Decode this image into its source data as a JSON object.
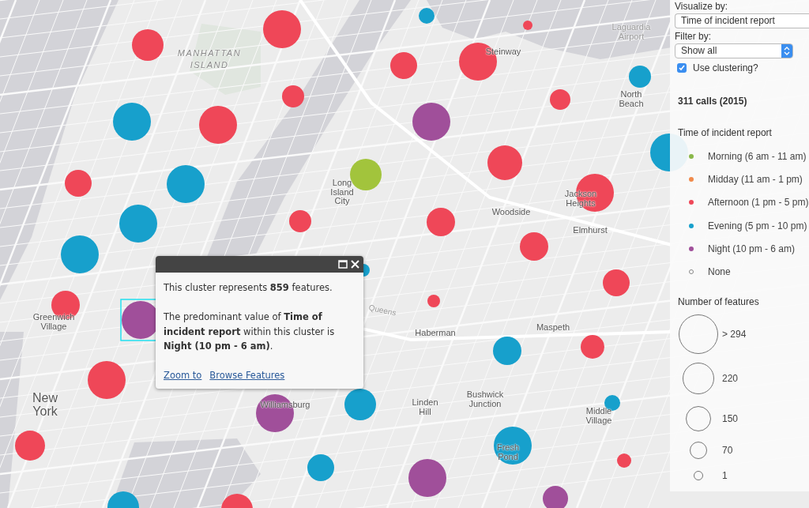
{
  "map": {
    "labels": [
      {
        "lines": [
          "MANHATTAN",
          "ISLAND"
        ],
        "kind": "area"
      },
      {
        "lines": [
          "Long",
          "Island",
          "City"
        ],
        "kind": "place"
      },
      {
        "lines": [
          "Steinway"
        ],
        "kind": "place"
      },
      {
        "lines": [
          "Laguardia",
          "Airport"
        ],
        "kind": "faint"
      },
      {
        "lines": [
          "North",
          "Beach"
        ],
        "kind": "place"
      },
      {
        "lines": [
          "Jackson",
          "Heights"
        ],
        "kind": "place"
      },
      {
        "lines": [
          "Woodside"
        ],
        "kind": "place"
      },
      {
        "lines": [
          "Elmhurst"
        ],
        "kind": "place"
      },
      {
        "lines": [
          "Greenwich",
          "Village"
        ],
        "kind": "place"
      },
      {
        "lines": [
          "New",
          "York"
        ],
        "kind": "city"
      },
      {
        "lines": [
          "Queens"
        ],
        "kind": "road"
      },
      {
        "lines": [
          "Haberman"
        ],
        "kind": "place"
      },
      {
        "lines": [
          "Maspeth"
        ],
        "kind": "place"
      },
      {
        "lines": [
          "Williamsburg"
        ],
        "kind": "place"
      },
      {
        "lines": [
          "Linden",
          "Hill"
        ],
        "kind": "place"
      },
      {
        "lines": [
          "Bushwick",
          "Junction"
        ],
        "kind": "place"
      },
      {
        "lines": [
          "Middle",
          "Village"
        ],
        "kind": "place"
      },
      {
        "lines": [
          "Fresh",
          "Pond"
        ],
        "kind": "place"
      }
    ],
    "clusters": [
      {
        "color": "#ef4758",
        "selected": false
      },
      {
        "color": "#ef4758",
        "selected": false
      },
      {
        "color": "#17a0cc",
        "selected": false
      },
      {
        "color": "#ef4758",
        "selected": false
      },
      {
        "color": "#ef4758",
        "selected": false
      },
      {
        "color": "#ef4758",
        "selected": false
      },
      {
        "color": "#ef4758",
        "selected": false
      },
      {
        "color": "#ef4758",
        "selected": false
      },
      {
        "color": "#17a0cc",
        "selected": false
      },
      {
        "color": "#a04f9a",
        "selected": false
      },
      {
        "color": "#ef4758",
        "selected": false
      },
      {
        "color": "#17a0cc",
        "selected": false
      },
      {
        "color": "#a2c43c",
        "selected": false
      },
      {
        "color": "#ef4758",
        "selected": false
      },
      {
        "color": "#17a0cc",
        "selected": false
      },
      {
        "color": "#ef4758",
        "selected": false
      },
      {
        "color": "#ef4758",
        "selected": false
      },
      {
        "color": "#17a0cc",
        "selected": false
      },
      {
        "color": "#17a0cc",
        "selected": false
      },
      {
        "color": "#ef4758",
        "selected": false
      },
      {
        "color": "#ef4758",
        "selected": false
      },
      {
        "color": "#ef4758",
        "selected": false
      },
      {
        "color": "#17a0cc",
        "selected": false
      },
      {
        "color": "#ef4758",
        "selected": false
      },
      {
        "color": "#17a0cc",
        "selected": false
      },
      {
        "color": "#ef4758",
        "selected": false
      },
      {
        "color": "#ef4758",
        "selected": false
      },
      {
        "color": "#a04f9a",
        "selected": true
      },
      {
        "color": "#17a0cc",
        "selected": false
      },
      {
        "color": "#ef4758",
        "selected": false
      },
      {
        "color": "#ef4758",
        "selected": false
      },
      {
        "color": "#ef4758",
        "selected": false
      },
      {
        "color": "#a04f9a",
        "selected": false
      },
      {
        "color": "#17a0cc",
        "selected": false
      },
      {
        "color": "#17a0cc",
        "selected": false
      },
      {
        "color": "#17a0cc",
        "selected": false
      },
      {
        "color": "#17a0cc",
        "selected": false
      },
      {
        "color": "#a04f9a",
        "selected": false
      },
      {
        "color": "#ef4758",
        "selected": false
      },
      {
        "color": "#a04f9a",
        "selected": false
      },
      {
        "color": "#17a0cc",
        "selected": false
      },
      {
        "color": "#ef4758",
        "selected": false
      }
    ]
  },
  "popup": {
    "paragraphs": [
      "This cluster represents **859** features.",
      "The predominant value of **Time of incident report** within this cluster is **Night (10 pm - 6 am)**."
    ],
    "links": [
      "Zoom to",
      "Browse Features"
    ]
  },
  "panel": {
    "visualize_by": {
      "label": "Visualize by:",
      "value": "Time of incident report"
    },
    "filter_by": {
      "label": "Filter by:",
      "value": "Show all"
    },
    "clustering": {
      "label": "Use clustering?",
      "checked": true
    },
    "count": "311 calls (2015)",
    "color_legend": {
      "title": "Time of incident report",
      "items": [
        {
          "label": "Morning (6 am - 11 am)",
          "color": "#8ab84a",
          "kind": "dot"
        },
        {
          "label": "Midday (11 am - 1 pm)",
          "color": "#f08a4b",
          "kind": "dot"
        },
        {
          "label": "Afternoon (1 pm - 5 pm)",
          "color": "#ef4758",
          "kind": "dot"
        },
        {
          "label": "Evening (5 pm - 10 pm)",
          "color": "#17a0cc",
          "kind": "dot"
        },
        {
          "label": "Night (10 pm - 6 am)",
          "color": "#a04f9a",
          "kind": "dot"
        },
        {
          "label": "None",
          "kind": "none"
        }
      ]
    },
    "size_legend": {
      "title": "Number of features",
      "items": [
        {
          "label": "> 294"
        },
        {
          "label": "220"
        },
        {
          "label": "150"
        },
        {
          "label": "70"
        },
        {
          "label": "1"
        }
      ]
    }
  }
}
